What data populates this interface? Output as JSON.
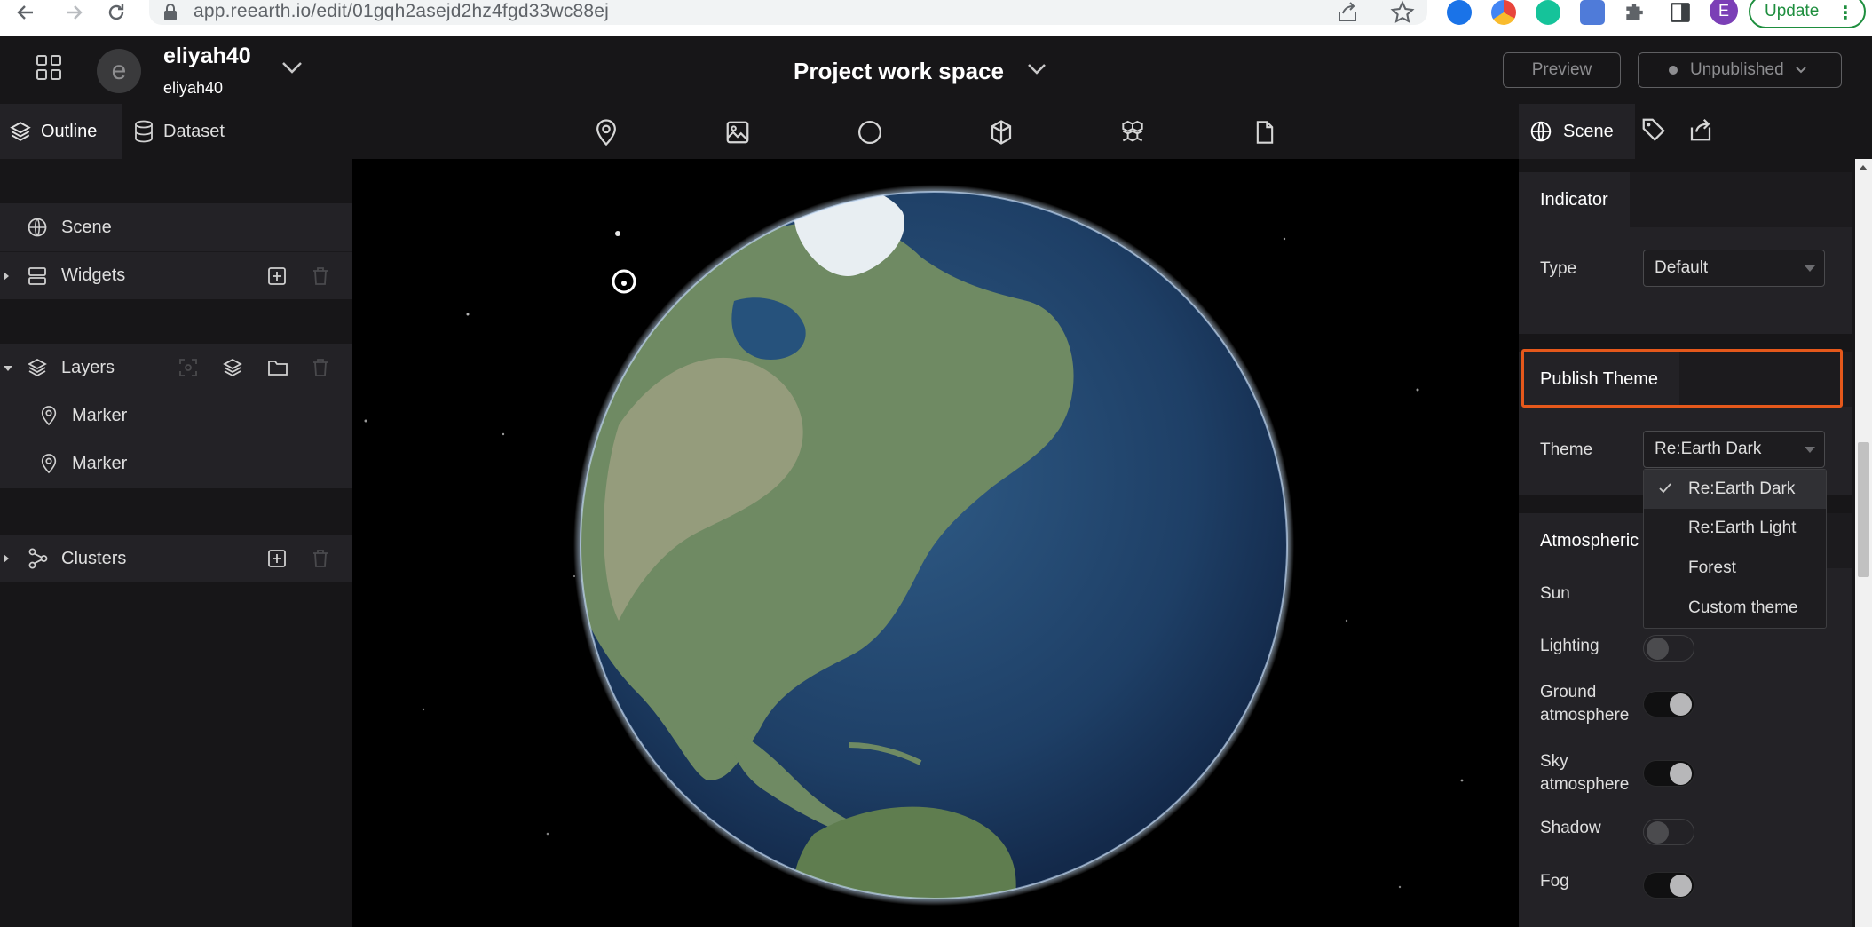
{
  "browser": {
    "url": "app.reearth.io/edit/01gqh2asejd2hz4fgd33wc88ej",
    "update_label": "Update",
    "profile_initial": "E",
    "colors": {
      "update_green": "#1e8e3e",
      "profile": "#7b3fb6"
    }
  },
  "header": {
    "user_name": "eliyah40",
    "user_sub": "eliyah40",
    "avatar_letter": "e",
    "project_title": "Project work space",
    "preview_label": "Preview",
    "publish_status": "Unpublished"
  },
  "left_tabs": {
    "outline": "Outline",
    "dataset": "Dataset"
  },
  "toolbar_icons": [
    "map-pin-icon",
    "image-icon",
    "circle-icon",
    "box-icon",
    "cube-3d-icon",
    "file-icon"
  ],
  "outline": {
    "scene": "Scene",
    "widgets": "Widgets",
    "layers": "Layers",
    "layer_items": [
      "Marker",
      "Marker"
    ],
    "clusters": "Clusters"
  },
  "right_tabs": {
    "scene": "Scene"
  },
  "right_panel": {
    "indicator": {
      "title": "Indicator",
      "type_label": "Type",
      "type_value": "Default"
    },
    "publish_theme": {
      "title": "Publish Theme",
      "theme_label": "Theme",
      "theme_value": "Re:Earth Dark",
      "options": [
        "Re:Earth Dark",
        "Re:Earth Light",
        "Forest",
        "Custom theme"
      ],
      "selected_index": 0
    },
    "atmospheric": {
      "title": "Atmospheric",
      "sun_label": "Sun",
      "lighting_label": "Lighting",
      "lighting_on": false,
      "ground_label_1": "Ground",
      "ground_label_2": "atmosphere",
      "ground_on": true,
      "sky_label_1": "Sky",
      "sky_label_2": "atmosphere",
      "sky_on": true,
      "shadow_label": "Shadow",
      "shadow_on": false,
      "fog_label": "Fog",
      "fog_on": true
    }
  },
  "accent_color": "#e5581b"
}
